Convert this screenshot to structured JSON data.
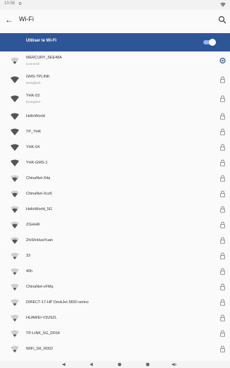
{
  "status_bar": {
    "time": "10:58",
    "extra_icon": "settings-icon",
    "battery_icon": "wifi-signal-icon"
  },
  "app_bar": {
    "title": "Wi-Fi",
    "back_icon": "arrow-back-icon",
    "search_icon": "search-icon"
  },
  "wifi_toggle": {
    "label": "Utiliser le Wi-Fi",
    "state": "on"
  },
  "colors": {
    "accent": "#2e5697",
    "switch_track": "#8fb4ea",
    "connected_icon": "#3b67b0"
  },
  "networks": [
    {
      "name": "MERCURY_5EE48A",
      "status": "Connecté",
      "signal": "low",
      "trailing": "gear-icon"
    },
    {
      "name": "GMS-TPLINK",
      "status": "Enregistré",
      "signal": "full",
      "trailing": "lock-icon"
    },
    {
      "name": "YHK-03",
      "status": "Enregistré",
      "signal": "full",
      "trailing": "lock-icon"
    },
    {
      "name": "HelloWorld",
      "signal": "full",
      "trailing": "lock-icon"
    },
    {
      "name": "TP_YHK",
      "signal": "full",
      "trailing": "lock-icon"
    },
    {
      "name": "YHK-04",
      "signal": "full",
      "trailing": "lock-icon"
    },
    {
      "name": "YHK-GMS-1",
      "signal": "full",
      "trailing": "lock-icon"
    },
    {
      "name": "ChinaNet-Xitq",
      "signal": "high",
      "trailing": "lock-icon"
    },
    {
      "name": "ChinaNet-Xcz6",
      "signal": "high",
      "trailing": "lock-icon"
    },
    {
      "name": "HelloWorld_5G",
      "signal": "high",
      "trailing": "lock-icon"
    },
    {
      "name": "ZGHHR",
      "signal": "high",
      "trailing": "lock-icon"
    },
    {
      "name": "ZhiShiHuaYuan",
      "signal": "high",
      "trailing": "lock-icon"
    },
    {
      "name": "33",
      "signal": "low",
      "trailing": "lock-icon"
    },
    {
      "name": "40h",
      "signal": "low",
      "trailing": "lock-icon"
    },
    {
      "name": "ChinaNet-vFMq",
      "signal": "low",
      "trailing": "lock-icon"
    },
    {
      "name": "DIRECT-17-HP DeskJet 3830 series",
      "signal": "low",
      "trailing": "lock-icon"
    },
    {
      "name": "HUAWEI-V3U6ZL",
      "signal": "low",
      "trailing": "lock-icon"
    },
    {
      "name": "TP-LINK_5G_DF64",
      "signal": "low",
      "trailing": "lock-icon"
    },
    {
      "name": "WIFI_SK_R002",
      "signal": "low",
      "trailing": "lock-icon"
    }
  ],
  "nav_bar": {
    "items": [
      "volume-down-icon",
      "back-icon",
      "home-icon",
      "recents-icon",
      "volume-up-icon"
    ]
  }
}
